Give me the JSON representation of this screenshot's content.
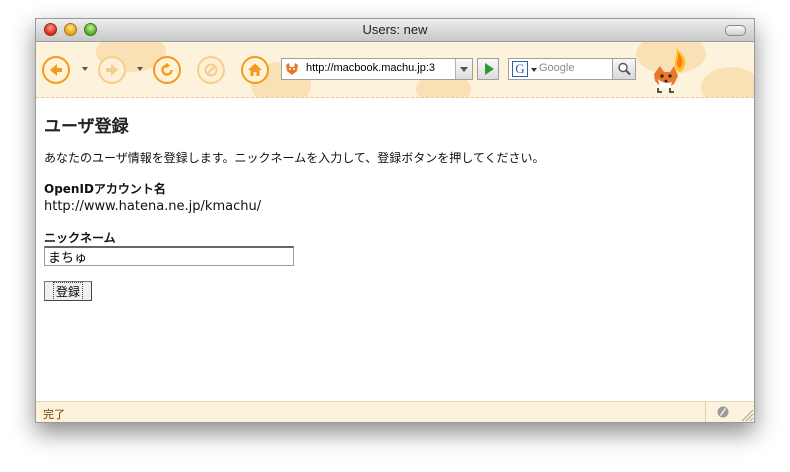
{
  "window": {
    "title": "Users: new"
  },
  "toolbar": {
    "url": "http://macbook.machu.jp:3",
    "search_placeholder": "Google",
    "search_engine_glyph": "G",
    "accent": "#f39b1f"
  },
  "page": {
    "heading": "ユーザ登録",
    "intro": "あなたのユーザ情報を登録します。ニックネームを入力して、登録ボタンを押してください。",
    "openid_label": "OpenIDアカウント名",
    "openid_value": "http://www.hatena.ne.jp/kmachu/",
    "nickname_label": "ニックネーム",
    "nickname_value": "まちゅ",
    "submit_label": "登録"
  },
  "status": {
    "text": "完了"
  }
}
